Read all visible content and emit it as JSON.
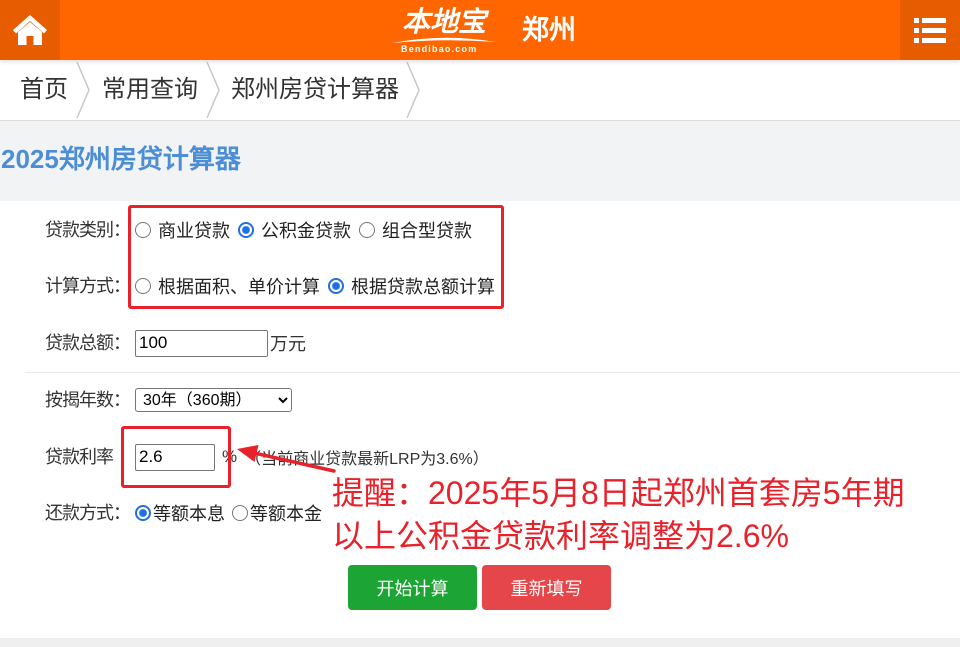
{
  "theme": {
    "header_bg": "#ff6600",
    "header_button_bg": "#e85c00",
    "title_color": "#4c8ed6",
    "calc_button_bg": "#1ca534",
    "reset_button_bg": "#e5464a",
    "annotation_color": "#e8212b",
    "radio_checked_color": "#1f6fe5"
  },
  "header": {
    "home_icon": "home-icon",
    "logo_text": "本地宝",
    "logo_subtext": "Bendibao.com",
    "city": "郑州",
    "menu_icon": "list-icon"
  },
  "breadcrumb": [
    {
      "label": "首页"
    },
    {
      "label": "常用查询"
    },
    {
      "label": "郑州房贷计算器"
    }
  ],
  "page_title": "2025郑州房贷计算器",
  "form": {
    "loan_type": {
      "label": "贷款类别：",
      "options": [
        {
          "label": "商业贷款",
          "checked": false
        },
        {
          "label": "公积金贷款",
          "checked": true
        },
        {
          "label": "组合型贷款",
          "checked": false
        }
      ]
    },
    "calc_method": {
      "label": "计算方式：",
      "options": [
        {
          "label": "根据面积、单价计算",
          "checked": false
        },
        {
          "label": "根据贷款总额计算",
          "checked": true
        }
      ]
    },
    "loan_amount": {
      "label": "贷款总额：",
      "value": "100",
      "unit": "万元"
    },
    "loan_years": {
      "label": "按揭年数：",
      "selected": "30年（360期）"
    },
    "loan_rate": {
      "label": "贷款利率",
      "value": "2.6",
      "unit": "%",
      "note": "（当前商业贷款最新LRP为3.6%）"
    },
    "repayment": {
      "label": "还款方式：",
      "options": [
        {
          "label": "等额本息",
          "checked": true
        },
        {
          "label": "等额本金",
          "checked": false
        }
      ]
    }
  },
  "buttons": {
    "calculate": "开始计算",
    "reset": "重新填写"
  },
  "annotation": {
    "line1": "提醒：2025年5月8日起郑州首套房5年期",
    "line2": "以上公积金贷款利率调整为2.6%"
  }
}
